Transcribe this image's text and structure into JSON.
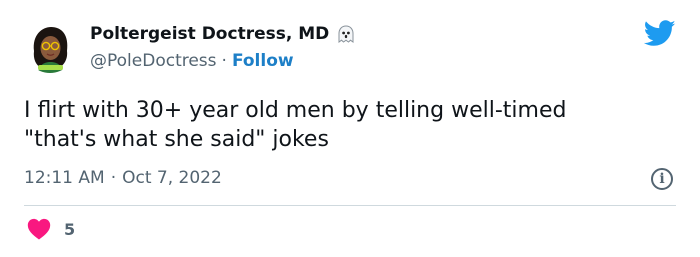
{
  "author": {
    "display_name": "Poltergeist Doctress, MD",
    "handle": "@PoleDoctress",
    "separator": "·",
    "follow_label": "Follow",
    "badge_icon": "ghost-icon",
    "avatar_icon": "avatar"
  },
  "tweet": {
    "text": "I flirt with 30+ year old men by telling well-timed\n\"that's what she said\" jokes",
    "time": "12:11 AM",
    "separator": "·",
    "date": "Oct 7, 2022"
  },
  "actions": {
    "like_count": "5",
    "like_icon": "heart-icon",
    "info_icon": "info-icon",
    "info_glyph": "i"
  },
  "brand": {
    "logo_icon": "twitter-bird-icon",
    "accent_color": "#1d9bf0",
    "like_color": "#f91880"
  }
}
